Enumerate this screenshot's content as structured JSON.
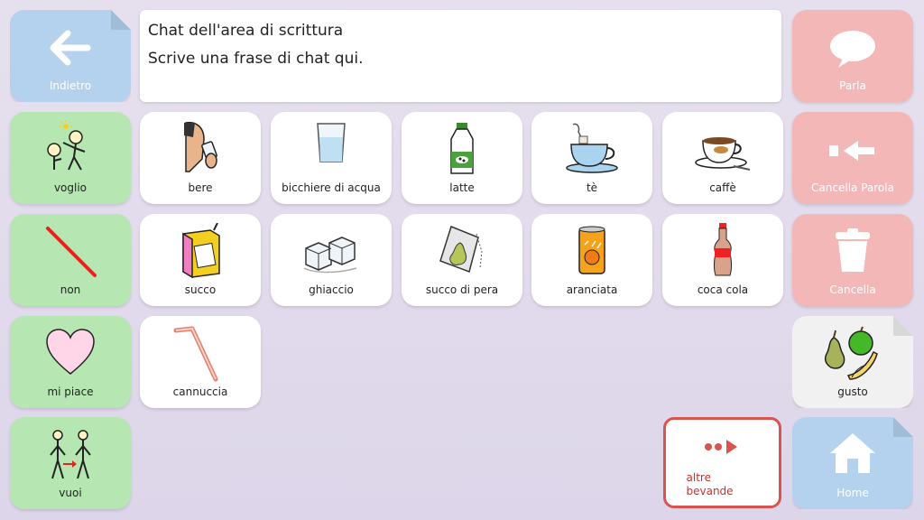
{
  "chat": {
    "line1": "Chat dell'area di scrittura",
    "line2": "Scrive una frase di chat qui."
  },
  "nav": {
    "back": "Indietro",
    "speak": "Parla",
    "delete_word": "Cancella Parola",
    "clear": "Cancella",
    "taste": "gusto",
    "home": "Home",
    "more": "altre bevande"
  },
  "left": {
    "want": "voglio",
    "no": "non",
    "like": "mi piace",
    "you": "vuoi"
  },
  "grid": {
    "drink": "bere",
    "water": "bicchiere di acqua",
    "milk": "latte",
    "tea": "tè",
    "coffee": "caffè",
    "juice": "succo",
    "ice": "ghiaccio",
    "pear_juice": "succo di pera",
    "orange": "aranciata",
    "cola": "coca cola",
    "straw": "cannuccia"
  },
  "colors": {
    "green": "#b6e7b3",
    "red": "#f3b7b8",
    "blue": "#b4d2ee",
    "accent_red": "#d9534f"
  }
}
